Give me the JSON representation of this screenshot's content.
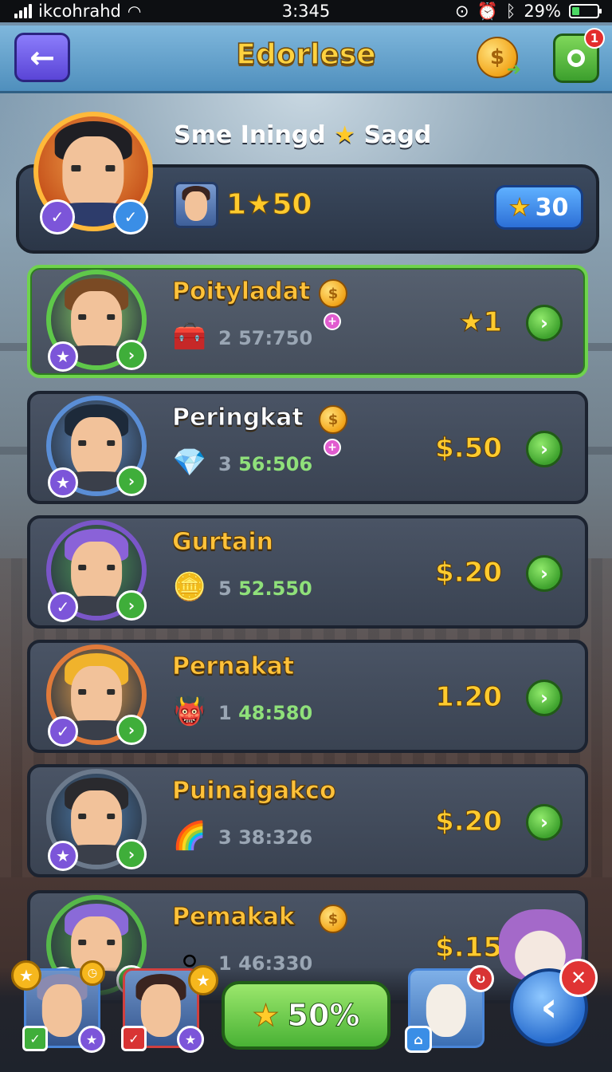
{
  "status_bar": {
    "carrier": "ikcohrahd",
    "time": "3:345",
    "battery_percent": "29%",
    "battery_level": 0.29
  },
  "header": {
    "title": "Edorlese",
    "notification_count": "1",
    "icons": [
      "back-arrow-icon",
      "coin-icon",
      "settings-ring-icon"
    ]
  },
  "player": {
    "title_part1": "Sme Iningd",
    "title_star": "★",
    "title_part2": "Sagd",
    "score_prefix": "1",
    "score_star": "★",
    "score_suffix": "50",
    "star_count": "30"
  },
  "rows": [
    {
      "name": "Poityladat",
      "stat_prefix": "2",
      "stat_value": "57:750",
      "price": "1",
      "price_has_star": true,
      "item_icon": "treasure-box-icon",
      "active": true,
      "avatar_hair": "#7a4a24",
      "avatar_ring": "#5fc84a",
      "avatar_bg": "#8bd36a"
    },
    {
      "name": "Peringkat",
      "stat_prefix": "3",
      "stat_value": "56:506",
      "price": "$.50",
      "price_has_star": false,
      "item_icon": "blue-gem-icon",
      "active": false,
      "avatar_hair": "#1d2a3a",
      "avatar_ring": "#5a8ed6",
      "avatar_bg": "#5f8fca"
    },
    {
      "name": "Gurtain",
      "stat_prefix": "5",
      "stat_value": "52.550",
      "price": "$.20",
      "price_has_star": false,
      "item_icon": "coin-icon",
      "active": false,
      "avatar_hair": "#8a62d8",
      "avatar_ring": "#7a56c8",
      "avatar_bg": "#4f9c5a"
    },
    {
      "name": "Pernakat",
      "stat_prefix": "1",
      "stat_value": "48:580",
      "price": "1.20",
      "price_has_star": false,
      "item_icon": "red-creature-icon",
      "active": false,
      "avatar_hair": "#f0b32c",
      "avatar_ring": "#e07a3a",
      "avatar_bg": "#e8a04a"
    },
    {
      "name": "Puinaigakco",
      "stat_prefix": "3",
      "stat_value": "38:326",
      "price": "$.20",
      "price_has_star": false,
      "item_icon": "rainbow-orb-icon",
      "active": false,
      "avatar_hair": "#2a2a2e",
      "avatar_ring": "#6c7a8c",
      "avatar_bg": "#4f7fb0"
    },
    {
      "name": "Pemakak",
      "stat_prefix": "1",
      "stat_value": "46:330",
      "price": "$.15",
      "price_has_star": false,
      "item_icon": "silver-orb-icon",
      "active": false,
      "avatar_hair": "#8a6ad8",
      "avatar_ring": "#56b84a",
      "avatar_bg": "#4c9a48"
    }
  ],
  "bottom": {
    "boost_label": "50%",
    "boost_star": "★"
  },
  "colors": {
    "accent_gold": "#ffc23a",
    "accent_green": "#49b235",
    "header_blue": "#4f8fbd",
    "row_bg": "#3a4352"
  }
}
